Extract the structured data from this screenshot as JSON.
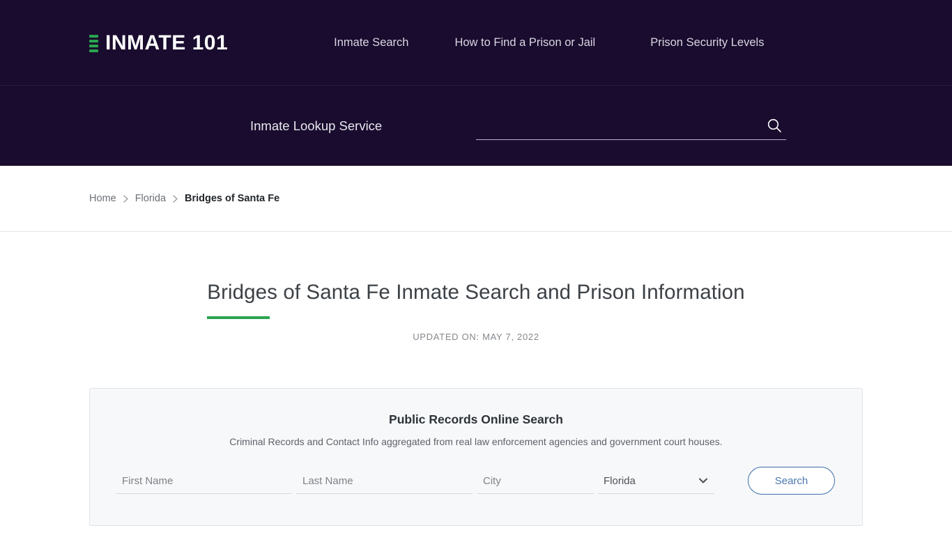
{
  "brand": {
    "name": "INMATE 101",
    "mark_bars": 4,
    "accent_color": "#2aa44f",
    "background_color": "#190c2e"
  },
  "topnav": {
    "items": [
      {
        "label": "Inmate Search"
      },
      {
        "label": "How to Find a Prison or Jail"
      },
      {
        "label": "Prison Security Levels"
      }
    ]
  },
  "searchbar": {
    "label": "Inmate Lookup Service",
    "input_value": "",
    "input_placeholder": "",
    "icon": "search-icon"
  },
  "breadcrumb": {
    "items": [
      {
        "label": "Home",
        "current": false
      },
      {
        "label": "Florida",
        "current": false
      },
      {
        "label": "Bridges of Santa Fe",
        "current": true
      }
    ],
    "separator_icon": "chevron-right-icon"
  },
  "main": {
    "title": "Bridges of Santa Fe Inmate Search and Prison Information",
    "updated": "UPDATED ON: MAY 7, 2022",
    "title_accent_color": "#2aa44f"
  },
  "records_card": {
    "title": "Public Records Online Search",
    "subtitle": "Criminal Records and Contact Info aggregated from real law enforcement agencies and government court houses.",
    "fields": {
      "first_name": {
        "value": "",
        "placeholder": "First Name"
      },
      "last_name": {
        "value": "",
        "placeholder": "Last Name"
      },
      "city": {
        "value": "",
        "placeholder": "City"
      },
      "state": {
        "value": "Florida",
        "caret_icon": "chevron-down-icon"
      }
    },
    "search_button": {
      "label": "Search",
      "border_color": "#3a6ea8",
      "text_color": "#4a78b0"
    }
  }
}
